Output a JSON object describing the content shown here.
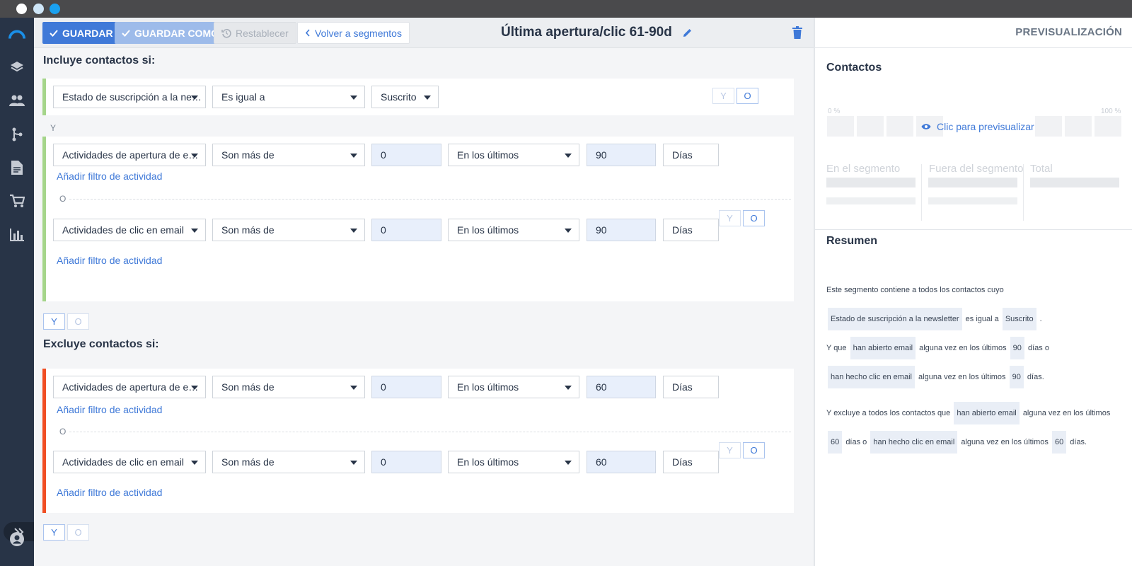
{
  "window": {
    "controls": [
      "close",
      "minimize",
      "maximize"
    ]
  },
  "sidebar": {
    "icons": [
      "logo-icon",
      "layers-icon",
      "contacts-icon",
      "automation-icon",
      "document-icon",
      "cart-icon",
      "stats-icon"
    ],
    "expand_icon": "chevrons-right-icon",
    "user_icon": "user-icon"
  },
  "toolbar": {
    "save_label": "GUARDAR",
    "save_as_label": "GUARDAR COMO",
    "reset_label": "Restablecer",
    "back_label": "Volver a segmentos",
    "segment_title": "Última apertura/clic 61-90d"
  },
  "include": {
    "heading": "Incluye contactos si:",
    "subscription_row": {
      "field": "Estado de suscripción a la ne…",
      "operator": "Es igual a",
      "value": "Suscrito",
      "y_label": "Y",
      "o_label": "O"
    },
    "and_label": "Y",
    "open_row": {
      "field": "Actividades de apertura de e…",
      "operator": "Son más de",
      "count": "0",
      "range": "En los últimos",
      "days": "90",
      "unit": "Días",
      "add_filter": "Añadir filtro de actividad"
    },
    "or_label": "O",
    "click_row": {
      "field": "Actividades de clic en email",
      "operator": "Son más de",
      "count": "0",
      "range": "En los últimos",
      "days": "90",
      "unit": "Días",
      "add_filter": "Añadir filtro de actividad",
      "y_label": "Y",
      "o_label": "O"
    },
    "footer_y": "Y",
    "footer_o": "O"
  },
  "exclude": {
    "heading": "Excluye contactos si:",
    "open_row": {
      "field": "Actividades de apertura de e…",
      "operator": "Son más de",
      "count": "0",
      "range": "En los últimos",
      "days": "60",
      "unit": "Días",
      "add_filter": "Añadir filtro de actividad"
    },
    "or_label": "O",
    "click_row": {
      "field": "Actividades de clic en email",
      "operator": "Son más de",
      "count": "0",
      "range": "En los últimos",
      "days": "60",
      "unit": "Días",
      "add_filter": "Añadir filtro de actividad",
      "y_label": "Y",
      "o_label": "O"
    },
    "footer_y": "Y",
    "footer_o": "O"
  },
  "preview": {
    "title": "PREVISUALIZACIÓN",
    "contacts_heading": "Contactos",
    "pct_min": "0 %",
    "pct_max": "100 %",
    "preview_link": "Clic para previsualizar",
    "in_segment": "En el segmento",
    "out_segment": "Fuera del segmento",
    "total": "Total"
  },
  "summary": {
    "heading": "Resumen",
    "s1_a": "Este segmento contiene a todos los contactos cuyo",
    "s1_chip1": "Estado de suscripción a la newsletter",
    "s1_b": "es igual a",
    "s1_chip2": "Suscrito",
    "s1_c": ".",
    "s2_a": "Y que",
    "s2_chip1": "han abierto email",
    "s2_b": "alguna vez en los últimos",
    "s2_chip2": "90",
    "s2_c": "días o",
    "s2_chip3": "han hecho clic en email",
    "s2_d": "alguna vez en los últimos",
    "s2_chip4": "90",
    "s2_e": "días.",
    "s3_a": "Y excluye a todos los contactos que",
    "s3_chip1": "han abierto email",
    "s3_b": "alguna vez en los últimos",
    "s3_chip2": "60",
    "s3_c": "días o",
    "s3_chip3": "han hecho clic en email",
    "s3_d": "alguna vez en los últimos",
    "s3_chip4": "60",
    "s3_e": "días."
  },
  "colors": {
    "accent": "#3f79d8",
    "include_bar": "#a5d58a",
    "exclude_bar": "#f04e23",
    "sidebar": "#283447"
  }
}
